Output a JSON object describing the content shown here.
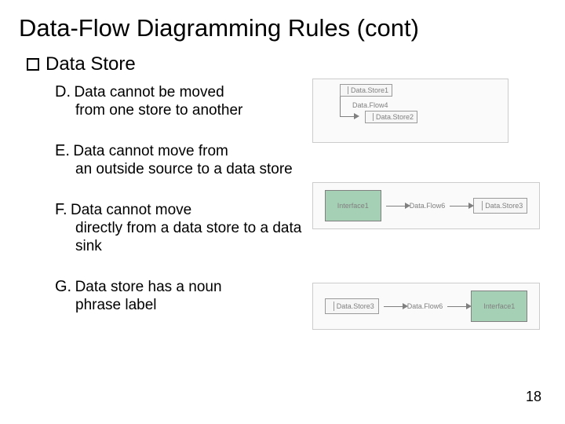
{
  "title": "Data-Flow Diagramming Rules (cont)",
  "section": {
    "label": "Data Store"
  },
  "items": {
    "d": {
      "letter": "D.",
      "first": "Data cannot be moved",
      "rest": "from one store to another"
    },
    "e": {
      "letter": "E.",
      "first": "Data cannot move from",
      "rest": "an outside source to a data store"
    },
    "f": {
      "letter": "F.",
      "first": "Data cannot move",
      "rest": "directly from a data store to a data sink"
    },
    "g": {
      "letter": "G.",
      "first": "Data store has a noun",
      "rest": "phrase label"
    }
  },
  "figures": {
    "d": {
      "store1": "Data.Store1",
      "flow": "Data.Flow4",
      "store2": "Data.Store2"
    },
    "e": {
      "interface": "Interface1",
      "flow": "Data.Flow6",
      "store": "Data.Store3"
    },
    "f": {
      "store": "Data.Store3",
      "flow": "Data.Flow6",
      "interface": "Interface1"
    }
  },
  "page_number": "18"
}
